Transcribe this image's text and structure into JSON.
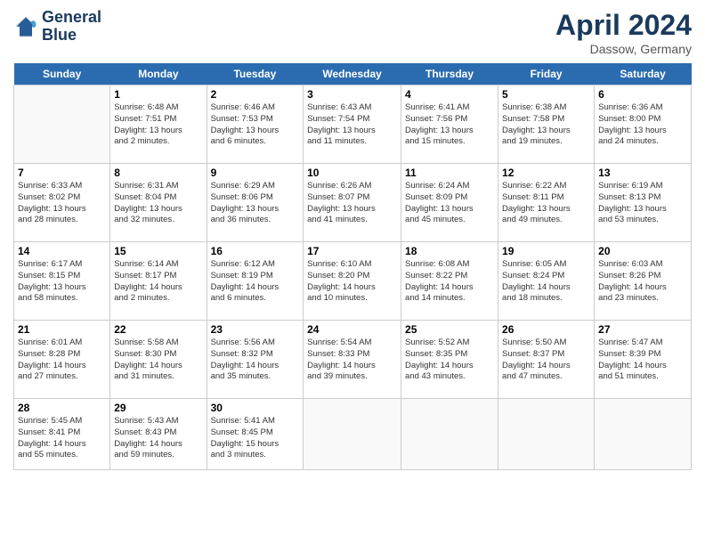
{
  "logo": {
    "line1": "General",
    "line2": "Blue"
  },
  "title": "April 2024",
  "subtitle": "Dassow, Germany",
  "headers": [
    "Sunday",
    "Monday",
    "Tuesday",
    "Wednesday",
    "Thursday",
    "Friday",
    "Saturday"
  ],
  "weeks": [
    [
      {
        "day": "",
        "info": ""
      },
      {
        "day": "1",
        "info": "Sunrise: 6:48 AM\nSunset: 7:51 PM\nDaylight: 13 hours\nand 2 minutes."
      },
      {
        "day": "2",
        "info": "Sunrise: 6:46 AM\nSunset: 7:53 PM\nDaylight: 13 hours\nand 6 minutes."
      },
      {
        "day": "3",
        "info": "Sunrise: 6:43 AM\nSunset: 7:54 PM\nDaylight: 13 hours\nand 11 minutes."
      },
      {
        "day": "4",
        "info": "Sunrise: 6:41 AM\nSunset: 7:56 PM\nDaylight: 13 hours\nand 15 minutes."
      },
      {
        "day": "5",
        "info": "Sunrise: 6:38 AM\nSunset: 7:58 PM\nDaylight: 13 hours\nand 19 minutes."
      },
      {
        "day": "6",
        "info": "Sunrise: 6:36 AM\nSunset: 8:00 PM\nDaylight: 13 hours\nand 24 minutes."
      }
    ],
    [
      {
        "day": "7",
        "info": "Sunrise: 6:33 AM\nSunset: 8:02 PM\nDaylight: 13 hours\nand 28 minutes."
      },
      {
        "day": "8",
        "info": "Sunrise: 6:31 AM\nSunset: 8:04 PM\nDaylight: 13 hours\nand 32 minutes."
      },
      {
        "day": "9",
        "info": "Sunrise: 6:29 AM\nSunset: 8:06 PM\nDaylight: 13 hours\nand 36 minutes."
      },
      {
        "day": "10",
        "info": "Sunrise: 6:26 AM\nSunset: 8:07 PM\nDaylight: 13 hours\nand 41 minutes."
      },
      {
        "day": "11",
        "info": "Sunrise: 6:24 AM\nSunset: 8:09 PM\nDaylight: 13 hours\nand 45 minutes."
      },
      {
        "day": "12",
        "info": "Sunrise: 6:22 AM\nSunset: 8:11 PM\nDaylight: 13 hours\nand 49 minutes."
      },
      {
        "day": "13",
        "info": "Sunrise: 6:19 AM\nSunset: 8:13 PM\nDaylight: 13 hours\nand 53 minutes."
      }
    ],
    [
      {
        "day": "14",
        "info": "Sunrise: 6:17 AM\nSunset: 8:15 PM\nDaylight: 13 hours\nand 58 minutes."
      },
      {
        "day": "15",
        "info": "Sunrise: 6:14 AM\nSunset: 8:17 PM\nDaylight: 14 hours\nand 2 minutes."
      },
      {
        "day": "16",
        "info": "Sunrise: 6:12 AM\nSunset: 8:19 PM\nDaylight: 14 hours\nand 6 minutes."
      },
      {
        "day": "17",
        "info": "Sunrise: 6:10 AM\nSunset: 8:20 PM\nDaylight: 14 hours\nand 10 minutes."
      },
      {
        "day": "18",
        "info": "Sunrise: 6:08 AM\nSunset: 8:22 PM\nDaylight: 14 hours\nand 14 minutes."
      },
      {
        "day": "19",
        "info": "Sunrise: 6:05 AM\nSunset: 8:24 PM\nDaylight: 14 hours\nand 18 minutes."
      },
      {
        "day": "20",
        "info": "Sunrise: 6:03 AM\nSunset: 8:26 PM\nDaylight: 14 hours\nand 23 minutes."
      }
    ],
    [
      {
        "day": "21",
        "info": "Sunrise: 6:01 AM\nSunset: 8:28 PM\nDaylight: 14 hours\nand 27 minutes."
      },
      {
        "day": "22",
        "info": "Sunrise: 5:58 AM\nSunset: 8:30 PM\nDaylight: 14 hours\nand 31 minutes."
      },
      {
        "day": "23",
        "info": "Sunrise: 5:56 AM\nSunset: 8:32 PM\nDaylight: 14 hours\nand 35 minutes."
      },
      {
        "day": "24",
        "info": "Sunrise: 5:54 AM\nSunset: 8:33 PM\nDaylight: 14 hours\nand 39 minutes."
      },
      {
        "day": "25",
        "info": "Sunrise: 5:52 AM\nSunset: 8:35 PM\nDaylight: 14 hours\nand 43 minutes."
      },
      {
        "day": "26",
        "info": "Sunrise: 5:50 AM\nSunset: 8:37 PM\nDaylight: 14 hours\nand 47 minutes."
      },
      {
        "day": "27",
        "info": "Sunrise: 5:47 AM\nSunset: 8:39 PM\nDaylight: 14 hours\nand 51 minutes."
      }
    ],
    [
      {
        "day": "28",
        "info": "Sunrise: 5:45 AM\nSunset: 8:41 PM\nDaylight: 14 hours\nand 55 minutes."
      },
      {
        "day": "29",
        "info": "Sunrise: 5:43 AM\nSunset: 8:43 PM\nDaylight: 14 hours\nand 59 minutes."
      },
      {
        "day": "30",
        "info": "Sunrise: 5:41 AM\nSunset: 8:45 PM\nDaylight: 15 hours\nand 3 minutes."
      },
      {
        "day": "",
        "info": ""
      },
      {
        "day": "",
        "info": ""
      },
      {
        "day": "",
        "info": ""
      },
      {
        "day": "",
        "info": ""
      }
    ]
  ]
}
